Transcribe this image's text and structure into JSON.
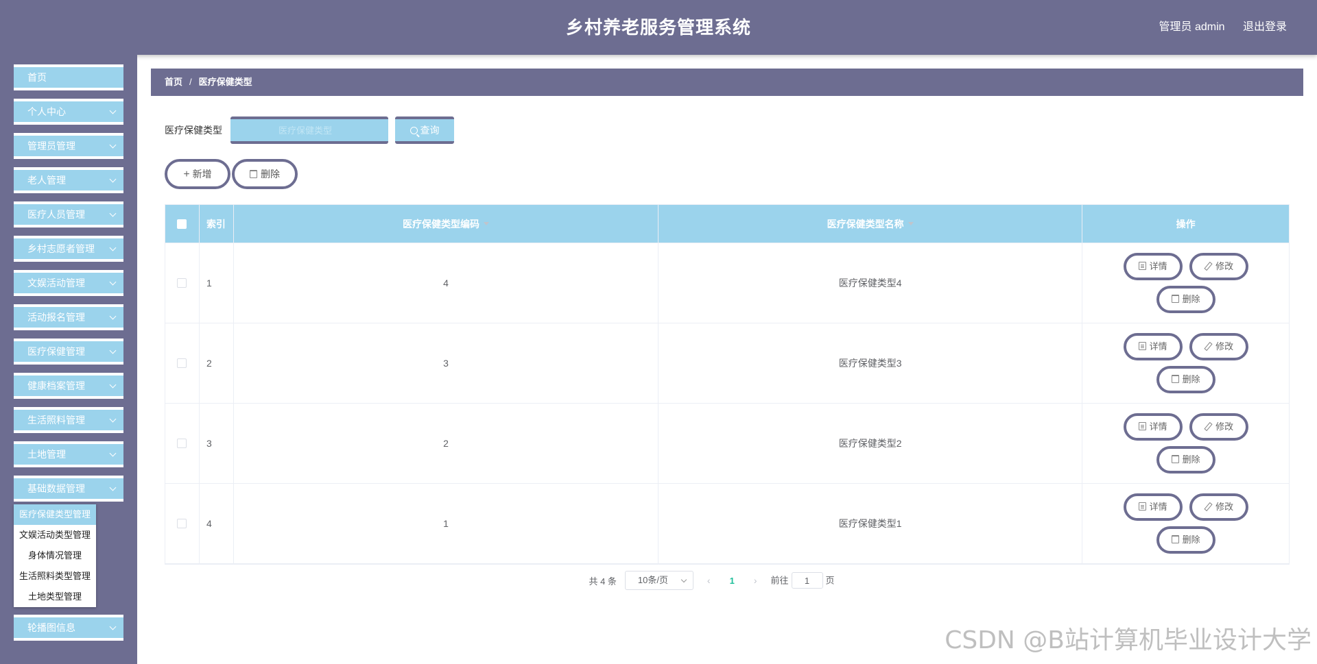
{
  "header": {
    "title": "乡村养老服务管理系统",
    "user": "管理员 admin",
    "logout": "退出登录"
  },
  "sidebar": {
    "items": [
      {
        "label": "首页",
        "has_sub": false
      },
      {
        "label": "个人中心",
        "has_sub": true
      },
      {
        "label": "管理员管理",
        "has_sub": true
      },
      {
        "label": "老人管理",
        "has_sub": true
      },
      {
        "label": "医疗人员管理",
        "has_sub": true
      },
      {
        "label": "乡村志愿者管理",
        "has_sub": true
      },
      {
        "label": "文娱活动管理",
        "has_sub": true
      },
      {
        "label": "活动报名管理",
        "has_sub": true
      },
      {
        "label": "医疗保健管理",
        "has_sub": true
      },
      {
        "label": "健康档案管理",
        "has_sub": true
      },
      {
        "label": "生活照料管理",
        "has_sub": true
      },
      {
        "label": "土地管理",
        "has_sub": true
      },
      {
        "label": "基础数据管理",
        "has_sub": true
      },
      {
        "label": "轮播图信息",
        "has_sub": true
      }
    ],
    "submenu": [
      "医疗保健类型管理",
      "文娱活动类型管理",
      "身体情况管理",
      "生活照料类型管理",
      "土地类型管理"
    ]
  },
  "breadcrumb": {
    "home": "首页",
    "current": "医疗保健类型"
  },
  "search": {
    "label": "医疗保健类型",
    "placeholder": "医疗保健类型",
    "button": "查询"
  },
  "actions": {
    "add": "新增",
    "delete": "删除"
  },
  "table": {
    "headers": {
      "index": "索引",
      "code": "医疗保健类型编码",
      "name": "医疗保健类型名称",
      "ops": "操作"
    },
    "rows": [
      {
        "index": "1",
        "code": "4",
        "name": "医疗保健类型4"
      },
      {
        "index": "2",
        "code": "3",
        "name": "医疗保健类型3"
      },
      {
        "index": "3",
        "code": "2",
        "name": "医疗保健类型2"
      },
      {
        "index": "4",
        "code": "1",
        "name": "医疗保健类型1"
      }
    ],
    "op_labels": {
      "detail": "详情",
      "edit": "修改",
      "delete": "删除"
    }
  },
  "pagination": {
    "total": "共 4 条",
    "page_size": "10条/页",
    "current_page": "1",
    "goto_label": "前往",
    "goto_value": "1",
    "goto_suffix": "页"
  },
  "watermark": "CSDN @B站计算机毕业设计大学",
  "colors": {
    "primary": "#6d6d91",
    "accent": "#9bd3ec",
    "active_page": "#1fbf9a"
  }
}
